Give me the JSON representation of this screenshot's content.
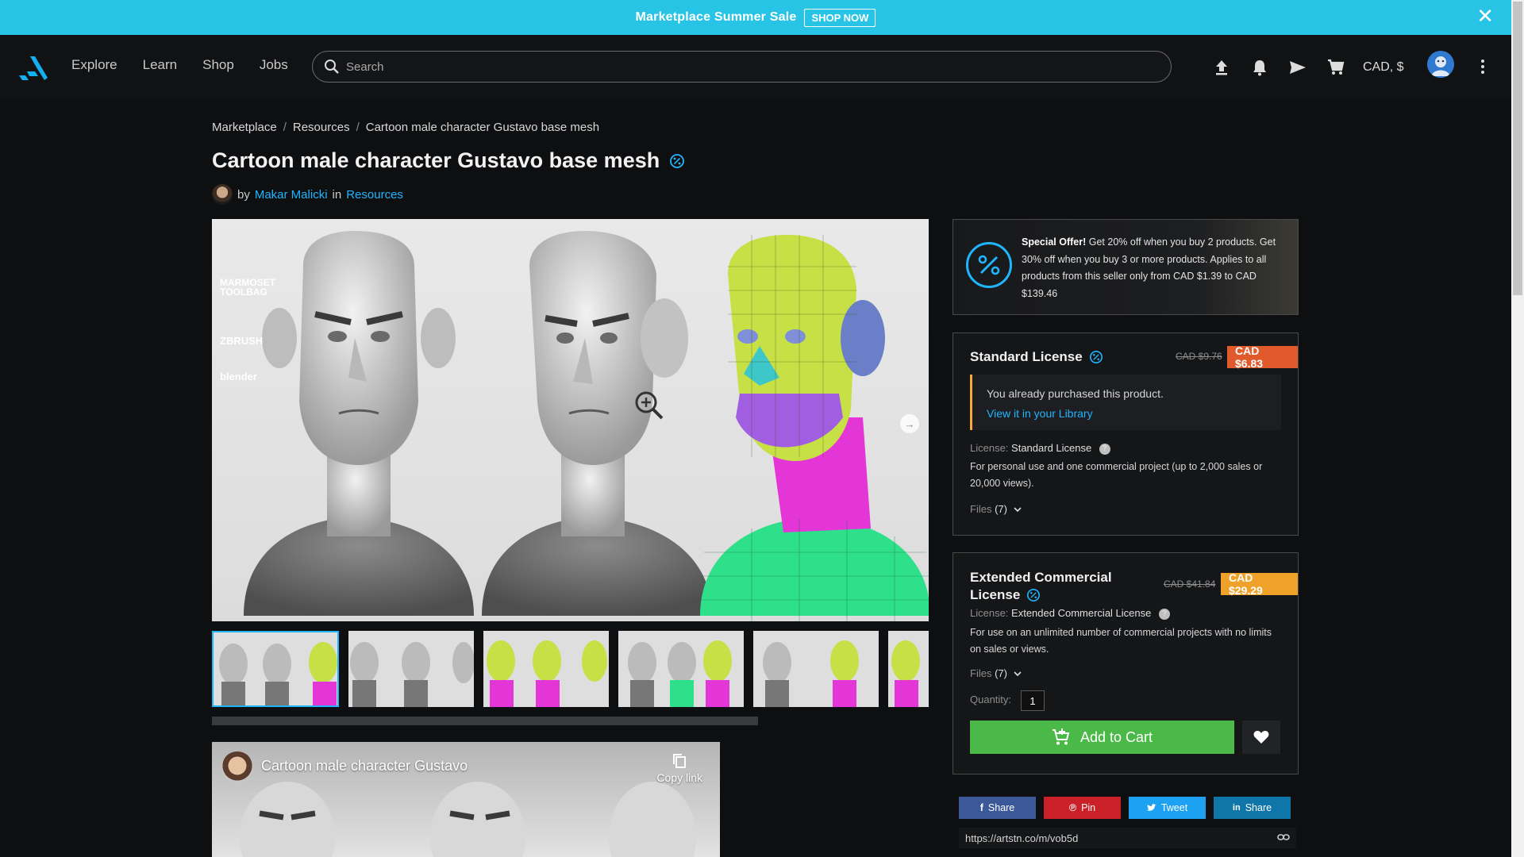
{
  "promo": {
    "text": "Marketplace Summer Sale",
    "button": "SHOP NOW",
    "close": "✕"
  },
  "header": {
    "nav": [
      "Explore",
      "Learn",
      "Shop",
      "Jobs"
    ],
    "search_placeholder": "Search",
    "currency": "CAD, $"
  },
  "breadcrumb": [
    "Marketplace",
    "Resources",
    "Cartoon male character Gustavo base mesh"
  ],
  "product": {
    "title": "Cartoon male character Gustavo base mesh",
    "by": "by",
    "author": "Makar Malicki",
    "in": "in",
    "category": "Resources"
  },
  "image_logos": {
    "marmoset": "MARMOSET TOOLBAG",
    "zbrush": "ZBRUSH",
    "blender": "blender"
  },
  "video": {
    "title": "Cartoon male character Gustavo",
    "copy_link": "Copy link"
  },
  "offer": {
    "headline": "Special Offer!",
    "text": " Get 20% off when you buy 2 products. Get 30% off when you buy 3 or more products. Applies to all products from this seller only from CAD $1.39 to CAD $139.46"
  },
  "standard": {
    "title": "Standard License",
    "price_old": "CAD $9.76",
    "price_new": "CAD $6.83",
    "purchased_text": "You already purchased this product.",
    "library_link": "View it in your Library",
    "license_label": "License:",
    "license_value": "Standard License",
    "description": "For personal use and one commercial project (up to 2,000 sales or 20,000 views).",
    "files_label": "Files",
    "files_count": "(7)"
  },
  "extended": {
    "title_line1": "Extended Commercial",
    "title_line2": "License",
    "price_old": "CAD $41.84",
    "price_new": "CAD $29.29",
    "license_label": "License:",
    "license_value": "Extended Commercial License",
    "description": "For use on an unlimited number of commercial projects with no limits on sales or views.",
    "files_label": "Files",
    "files_count": "(7)",
    "quantity_label": "Quantity:",
    "quantity_value": "1",
    "add_to_cart": "Add to Cart"
  },
  "share": {
    "facebook": "Share",
    "pinterest": "Pin",
    "twitter": "Tweet",
    "linkedin": "Share",
    "url": "https://artstn.co/m/vob5d"
  },
  "colors": {
    "promo_bg": "#27c4e6",
    "accent": "#1fb6ff",
    "std_price_bg": "#e15a2b",
    "ext_price_bg": "#f0a12a",
    "add_cart_bg": "#4bb948",
    "facebook": "#3b5998",
    "pinterest": "#cb2027",
    "twitter": "#1da1f2",
    "linkedin": "#0e76a8"
  }
}
